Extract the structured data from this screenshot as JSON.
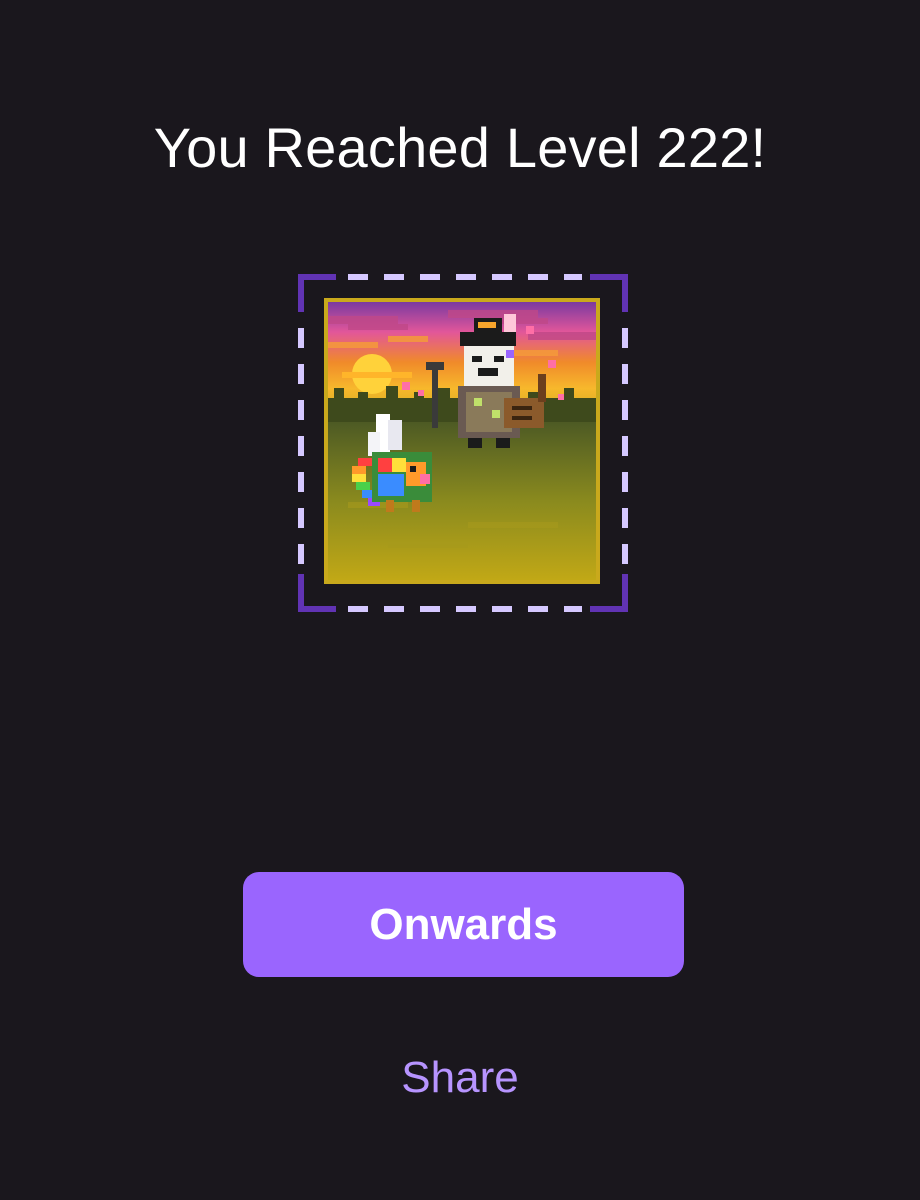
{
  "levelup": {
    "title": "You Reached Level 222!"
  },
  "avatar": {
    "icon": "pixel-avatar-with-pet",
    "frame_color": "#6133b4",
    "dash_color": "#d5c8ff",
    "border_color": "#c9a91c"
  },
  "actions": {
    "onwards_label": "Onwards",
    "share_label": "Share"
  },
  "colors": {
    "background": "#1a171d",
    "primary_button": "#9a65fe",
    "link": "#b794ff"
  }
}
